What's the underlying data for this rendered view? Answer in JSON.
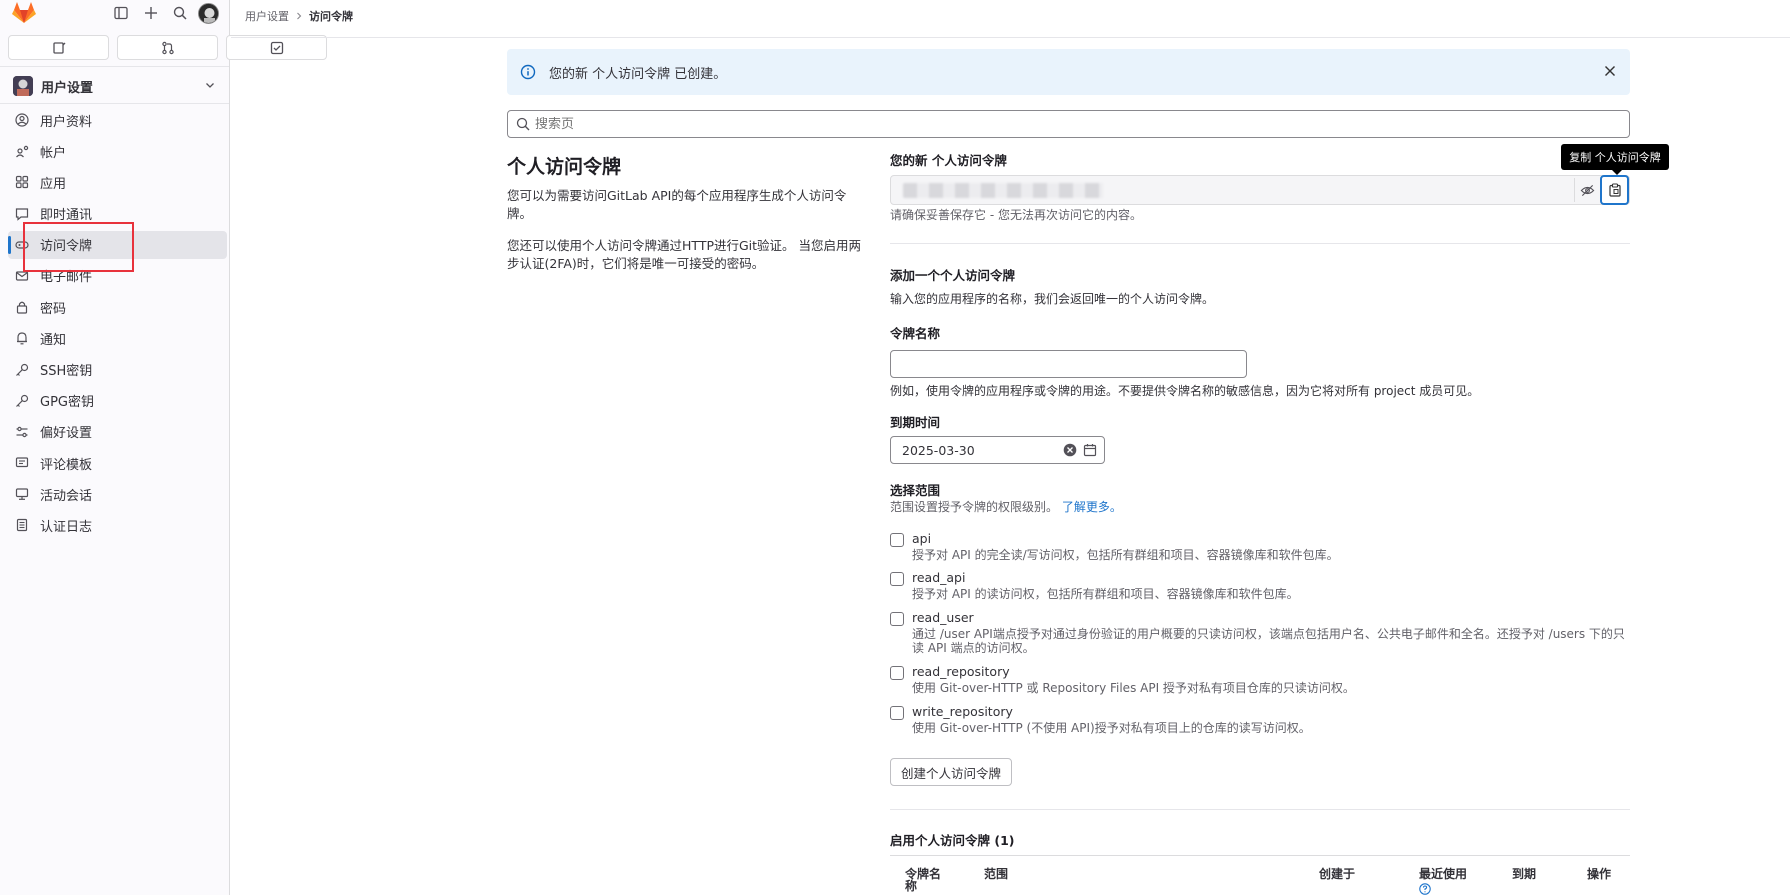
{
  "breadcrumb": {
    "parent": "用户设置",
    "current": "访问令牌"
  },
  "sidebar": {
    "context_title": "用户设置",
    "items": [
      {
        "label": "用户资料",
        "icon": "profile-icon"
      },
      {
        "label": "帐户",
        "icon": "account-icon"
      },
      {
        "label": "应用",
        "icon": "applications-icon"
      },
      {
        "label": "即时通讯",
        "icon": "chat-icon"
      },
      {
        "label": "访问令牌",
        "icon": "token-icon",
        "active": true
      },
      {
        "label": "电子邮件",
        "icon": "mail-icon"
      },
      {
        "label": "密码",
        "icon": "lock-icon"
      },
      {
        "label": "通知",
        "icon": "notifications-icon"
      },
      {
        "label": "SSH密钥",
        "icon": "key-icon"
      },
      {
        "label": "GPG密钥",
        "icon": "key-icon"
      },
      {
        "label": "偏好设置",
        "icon": "preferences-icon"
      },
      {
        "label": "评论模板",
        "icon": "comment-template-icon"
      },
      {
        "label": "活动会话",
        "icon": "sessions-icon"
      },
      {
        "label": "认证日志",
        "icon": "log-icon"
      }
    ]
  },
  "alert": {
    "text": "您的新 个人访问令牌 已创建。"
  },
  "search": {
    "placeholder": "搜索页"
  },
  "intro": {
    "title": "个人访问令牌",
    "p1": "您可以为需要访问GitLab API的每个应用程序生成个人访问令牌。",
    "p2": "您还可以使用个人访问令牌通过HTTP进行Git验证。 当您启用两步认证(2FA)时，它们将是唯一可接受的密码。"
  },
  "new_token": {
    "label": "您的新 个人访问令牌",
    "tooltip": "复制 个人访问令牌",
    "hint": "请确保妥善保存它 - 您无法再次访问它的内容。"
  },
  "add_form": {
    "title": "添加一个个人访问令牌",
    "subtitle": "输入您的应用程序的名称，我们会返回唯一的个人访问令牌。",
    "name_label": "令牌名称",
    "name_value": "",
    "name_hint": "例如，使用令牌的应用程序或令牌的用途。不要提供令牌名称的敏感信息，因为它将对所有 project 成员可见。",
    "expiry_label": "到期时间",
    "expiry_value": "2025-03-30",
    "scope_label": "选择范围",
    "scope_hint": "范围设置授予令牌的权限级别。",
    "learn_more": "了解更多。",
    "scopes": [
      {
        "name": "api",
        "desc": "授予对 API 的完全读/写访问权，包括所有群组和项目、容器镜像库和软件包库。"
      },
      {
        "name": "read_api",
        "desc": "授予对 API 的读访问权，包括所有群组和项目、容器镜像库和软件包库。"
      },
      {
        "name": "read_user",
        "desc": "通过 /user API端点授予对通过身份验证的用户概要的只读访问权，该端点包括用户名、公共电子邮件和全名。还授予对 /users 下的只读 API 端点的访问权。"
      },
      {
        "name": "read_repository",
        "desc": "使用 Git-over-HTTP 或 Repository Files API 授予对私有项目仓库的只读访问权。"
      },
      {
        "name": "write_repository",
        "desc": "使用 Git-over-HTTP (不使用 API)授予对私有项目上的仓库的读写访问权。"
      }
    ],
    "submit": "创建个人访问令牌"
  },
  "active_tokens": {
    "title": "启用个人访问令牌 (1)",
    "headers": [
      "令牌名称",
      "范围",
      "创建于",
      "最近使用",
      "到期",
      "操作"
    ]
  },
  "colors": {
    "accent": "#1f75cb",
    "alert_bg": "#e9f3fc",
    "highlight_box": "#e8323c"
  }
}
